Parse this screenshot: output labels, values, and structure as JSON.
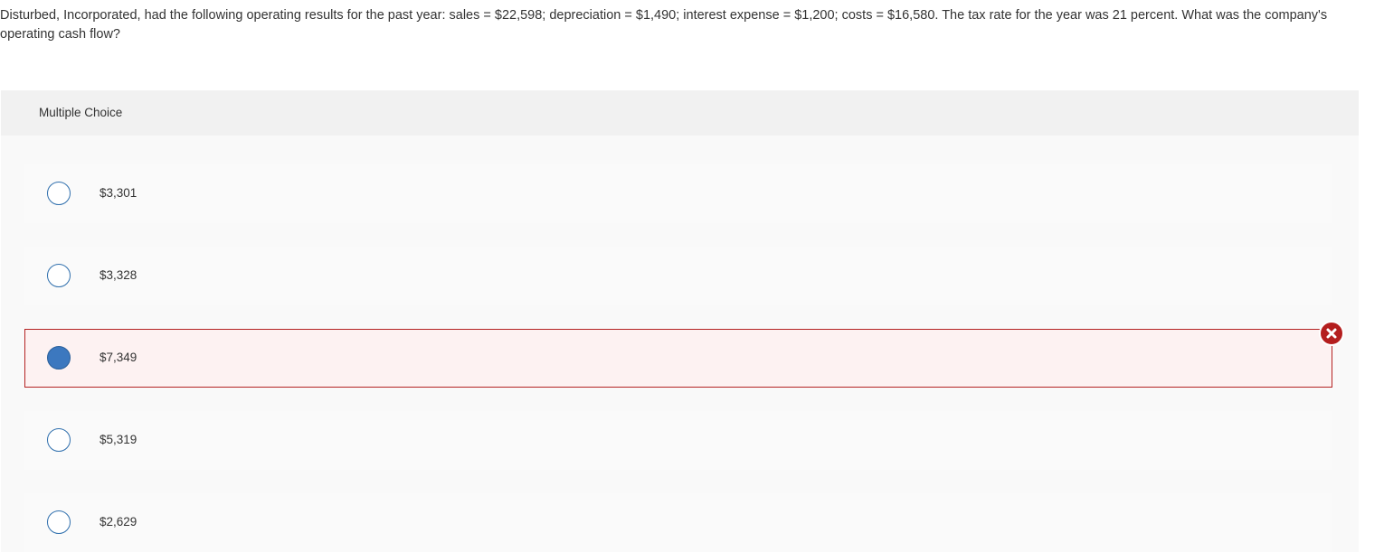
{
  "question": {
    "text": "Disturbed, Incorporated, had the following operating results for the past year: sales = $22,598; depreciation = $1,490; interest expense = $1,200; costs = $16,580. The tax rate for the year was 21 percent. What was the company's operating cash flow?"
  },
  "multiple_choice": {
    "header_label": "Multiple Choice",
    "options": [
      {
        "label": "$3,301",
        "selected": false,
        "status": "unselected"
      },
      {
        "label": "$3,328",
        "selected": false,
        "status": "unselected"
      },
      {
        "label": "$7,349",
        "selected": true,
        "status": "incorrect"
      },
      {
        "label": "$5,319",
        "selected": false,
        "status": "unselected"
      },
      {
        "label": "$2,629",
        "selected": false,
        "status": "unselected"
      }
    ]
  },
  "icons": {
    "incorrect_marker": "x-circle-icon"
  },
  "colors": {
    "radio_border": "#2f6fad",
    "radio_selected_fill": "#3c78bf",
    "incorrect_border": "#b42323",
    "incorrect_background": "#fdf2f2",
    "incorrect_badge": "#b41e1e"
  }
}
